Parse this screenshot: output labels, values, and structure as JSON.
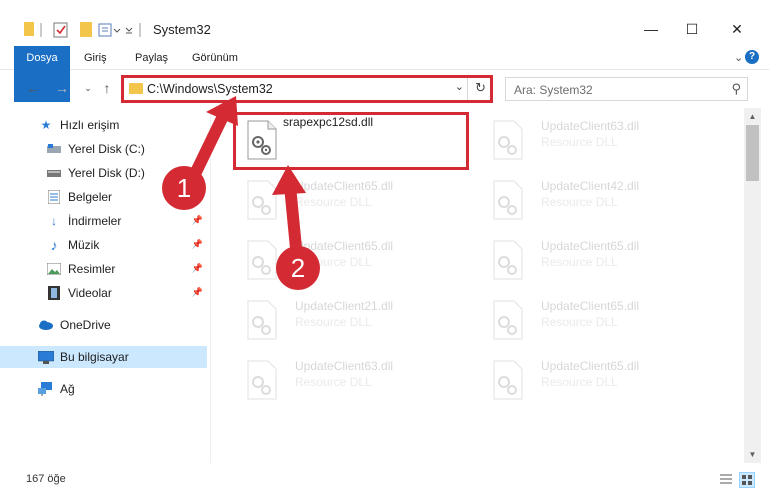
{
  "window": {
    "title": "System32",
    "minimize": "—",
    "maximize": "☐",
    "close": "✕"
  },
  "ribbon": {
    "tabs": [
      "Dosya",
      "Giriş",
      "Paylaş",
      "Görünüm"
    ],
    "expand": "⌄",
    "help": "?"
  },
  "address": {
    "path": "C:\\Windows\\System32",
    "search_placeholder": "Ara: System32"
  },
  "sidebar": {
    "items": [
      {
        "label": "Hızlı erişim",
        "icon": "star-icon"
      },
      {
        "label": "Yerel Disk (C:)",
        "icon": "drive-icon"
      },
      {
        "label": "Yerel Disk (D:)",
        "icon": "drive-icon"
      },
      {
        "label": "Belgeler",
        "icon": "documents-icon"
      },
      {
        "label": "İndirmeler",
        "icon": "download-icon"
      },
      {
        "label": "Müzik",
        "icon": "music-icon"
      },
      {
        "label": "Resimler",
        "icon": "pictures-icon"
      },
      {
        "label": "Videolar",
        "icon": "videos-icon"
      },
      {
        "label": "OneDrive",
        "icon": "cloud-icon"
      },
      {
        "label": "Bu bilgisayar",
        "icon": "computer-icon"
      },
      {
        "label": "Ağ",
        "icon": "network-icon"
      }
    ]
  },
  "files": {
    "main": {
      "name": "srapexpc12sd.dll"
    },
    "faded": [
      {
        "name": "UpdateClient63.dll",
        "type": "Resource DLL"
      },
      {
        "name": "UpdateClient65.dll",
        "type": "Resource DLL"
      },
      {
        "name": "UpdateClient42.dll",
        "type": "Resource DLL"
      },
      {
        "name": "UpdateClient65.dll",
        "type": "Resource DLL"
      },
      {
        "name": "UpdateClient65.dll",
        "type": "Resource DLL"
      },
      {
        "name": "UpdateClient21.dll",
        "type": "Resource DLL"
      },
      {
        "name": "UpdateClient65.dll",
        "type": "Resource DLL"
      },
      {
        "name": "UpdateClient63.dll",
        "type": "Resource DLL"
      },
      {
        "name": "UpdateClient65.dll",
        "type": "Resource DLL"
      }
    ]
  },
  "status": {
    "count": "167 öğe"
  },
  "annotations": {
    "step1": "1",
    "step2": "2",
    "color": "#d42a33"
  }
}
